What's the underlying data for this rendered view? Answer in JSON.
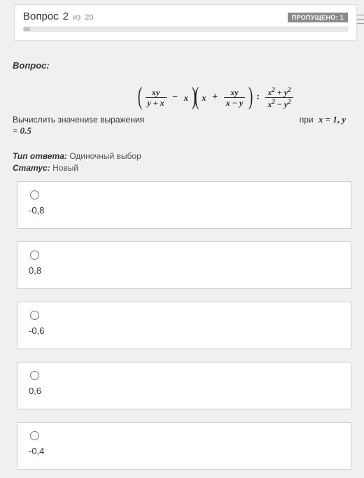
{
  "header": {
    "word": "Вопрос",
    "number": "2",
    "of_word": "из",
    "total": "20",
    "badge": "ПРОПУЩЕНО: 1"
  },
  "question": {
    "label": "Вопрос:",
    "prompt_prefix": "Вычислить значениsе выражения",
    "at_word": "при",
    "condition_x_var": "x",
    "condition_x_val": "1",
    "condition_sep": ",",
    "condition_y_var": "y",
    "condition_y_val": "0.5",
    "expr": {
      "f1_num": "xy",
      "f1_den": "y + x",
      "minus": "−",
      "t1": "x",
      "t2": "x",
      "plus": "+",
      "f2_num": "xy",
      "f2_den": "x − y",
      "colon": ":",
      "f3_num_a": "x",
      "f3_num_b": "y",
      "f3_den_a": "x",
      "f3_den_b": "y",
      "sq": "2"
    }
  },
  "meta": {
    "type_label": "Тип ответа:",
    "type_value": "Одиночный выбор",
    "status_label": "Статус:",
    "status_value": "Новый"
  },
  "options": [
    {
      "text": "-0,8"
    },
    {
      "text": "0,8"
    },
    {
      "text": "-0,6"
    },
    {
      "text": "0,6"
    },
    {
      "text": "-0,4"
    }
  ]
}
